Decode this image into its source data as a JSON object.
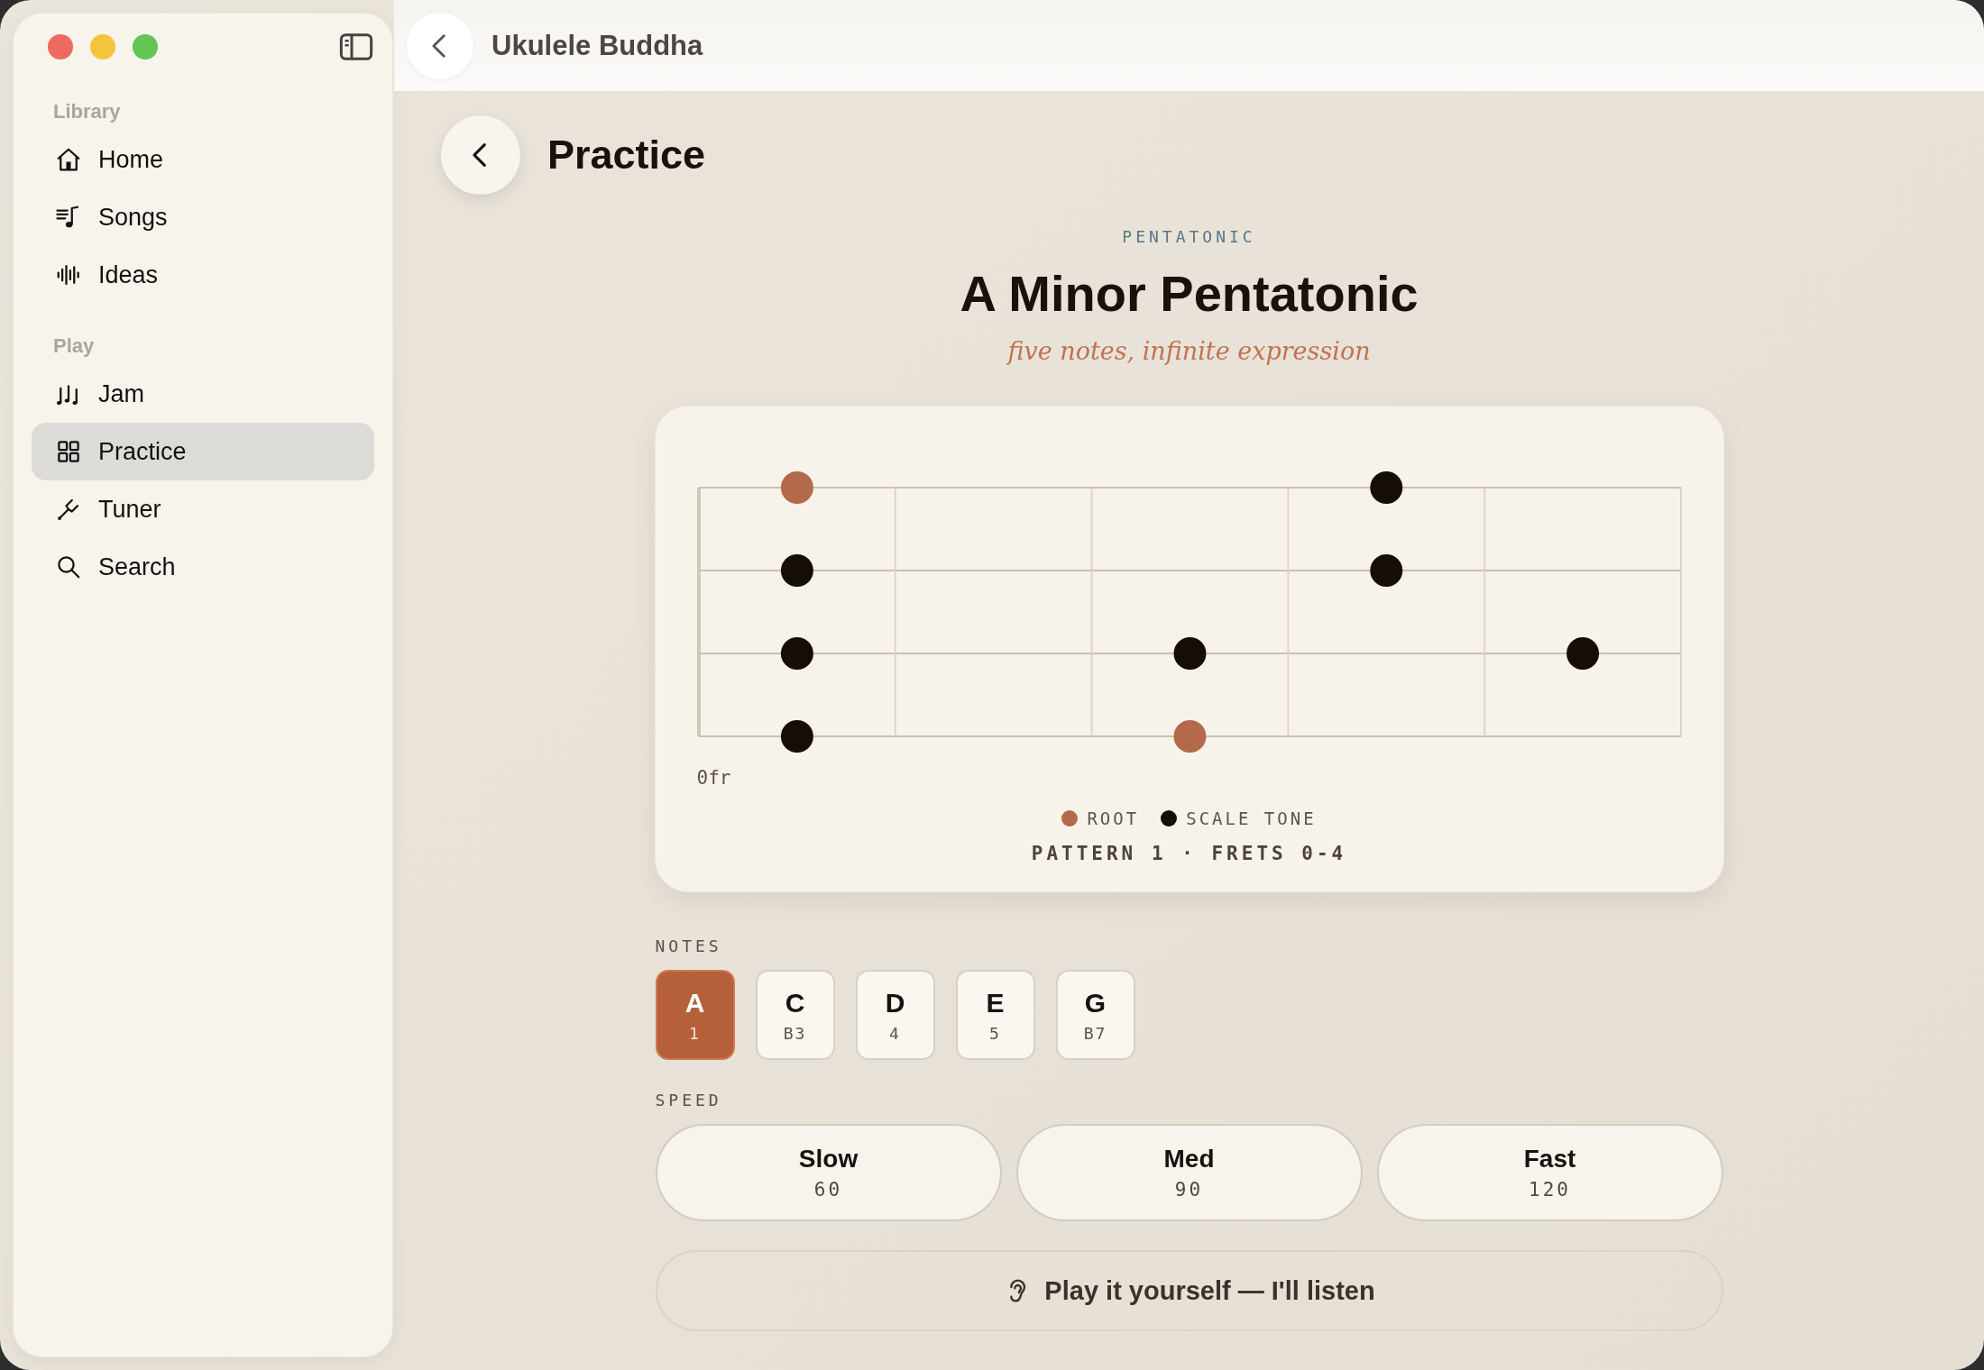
{
  "window": {
    "title": "Ukulele Buddha"
  },
  "sidebar": {
    "sections": [
      {
        "heading": "Library",
        "items": [
          {
            "label": "Home",
            "selected": false
          },
          {
            "label": "Songs",
            "selected": false
          },
          {
            "label": "Ideas",
            "selected": false
          }
        ]
      },
      {
        "heading": "Play",
        "items": [
          {
            "label": "Jam",
            "selected": false
          },
          {
            "label": "Practice",
            "selected": true
          },
          {
            "label": "Tuner",
            "selected": false
          },
          {
            "label": "Search",
            "selected": false
          }
        ]
      }
    ]
  },
  "page": {
    "title": "Practice"
  },
  "scale": {
    "category": "PENTATONIC",
    "title": "A Minor Pentatonic",
    "tagline": "five notes, infinite expression"
  },
  "fretboard": {
    "strings": [
      {
        "cells": [
          {
            "kind": "root"
          },
          {
            "kind": "none"
          },
          {
            "kind": "none"
          },
          {
            "kind": "scale"
          },
          {
            "kind": "none"
          }
        ]
      },
      {
        "cells": [
          {
            "kind": "scale"
          },
          {
            "kind": "none"
          },
          {
            "kind": "none"
          },
          {
            "kind": "scale"
          },
          {
            "kind": "none"
          }
        ]
      },
      {
        "cells": [
          {
            "kind": "scale"
          },
          {
            "kind": "none"
          },
          {
            "kind": "scale"
          },
          {
            "kind": "none"
          },
          {
            "kind": "scale"
          }
        ]
      },
      {
        "cells": [
          {
            "kind": "scale"
          },
          {
            "kind": "none"
          },
          {
            "kind": "root"
          },
          {
            "kind": "none"
          },
          {
            "kind": "none"
          }
        ]
      }
    ],
    "fret_label": "0fr",
    "legend": [
      {
        "kind": "root",
        "label": "ROOT",
        "color": "#b3694a"
      },
      {
        "kind": "scale",
        "label": "SCALE TONE",
        "color": "#140e06"
      }
    ],
    "pattern": "PATTERN 1 · FRETS 0-4"
  },
  "notes": {
    "label": "NOTES",
    "items": [
      {
        "name": "A",
        "degree": "1",
        "selected": true
      },
      {
        "name": "C",
        "degree": "B3",
        "selected": false
      },
      {
        "name": "D",
        "degree": "4",
        "selected": false
      },
      {
        "name": "E",
        "degree": "5",
        "selected": false
      },
      {
        "name": "G",
        "degree": "B7",
        "selected": false
      }
    ]
  },
  "speed": {
    "label": "SPEED",
    "options": [
      {
        "name": "Slow",
        "bpm": "60",
        "selected": false
      },
      {
        "name": "Med",
        "bpm": "90",
        "selected": false
      },
      {
        "name": "Fast",
        "bpm": "120",
        "selected": false
      }
    ]
  },
  "listen_button": {
    "label": "Play it yourself — I'll listen"
  }
}
